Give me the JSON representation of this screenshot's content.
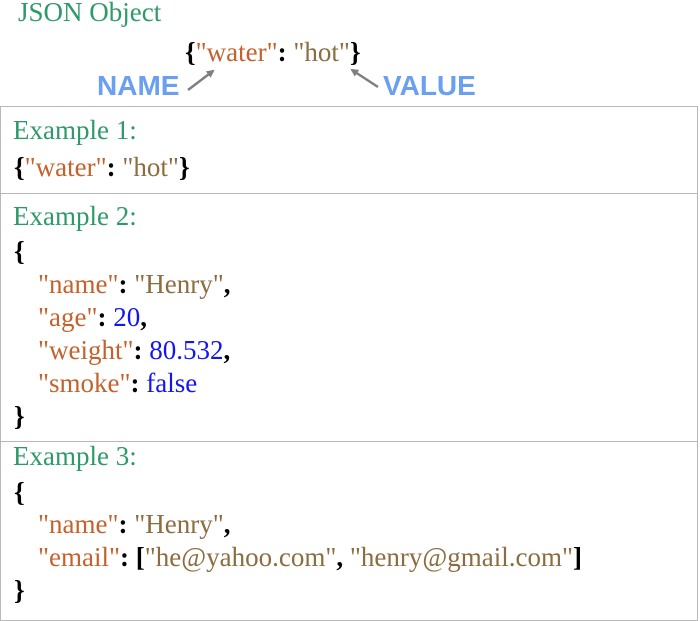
{
  "header": {
    "title": "JSON Object",
    "hero": {
      "key": "\"water\"",
      "value": "\"hot\""
    },
    "name_label": "NAME",
    "value_label": "VALUE"
  },
  "examples": [
    {
      "title": "Example 1:",
      "inline": {
        "key": "\"water\"",
        "value": "\"hot\""
      }
    },
    {
      "title": "Example 2:",
      "pairs": [
        {
          "key": "\"name\"",
          "value": "\"Henry\"",
          "type": "string"
        },
        {
          "key": "\"age\"",
          "value": "20",
          "type": "number"
        },
        {
          "key": "\"weight\"",
          "value": "80.532",
          "type": "number"
        },
        {
          "key": "\"smoke\"",
          "value": "false",
          "type": "boolean"
        }
      ]
    },
    {
      "title": "Example 3:",
      "pairs": [
        {
          "key": "\"name\"",
          "value": "\"Henry\"",
          "type": "string"
        },
        {
          "key": "\"email\"",
          "array": [
            "\"he@yahoo.com\"",
            "\"henry@gmail.com\""
          ],
          "type": "array"
        }
      ]
    }
  ],
  "colors": {
    "title": "#2e9a6a",
    "key": "#c4622d",
    "string": "#8b6d40",
    "number": "#1515ee",
    "label": "#6aa0ef",
    "arrow": "#7f7f7f"
  }
}
